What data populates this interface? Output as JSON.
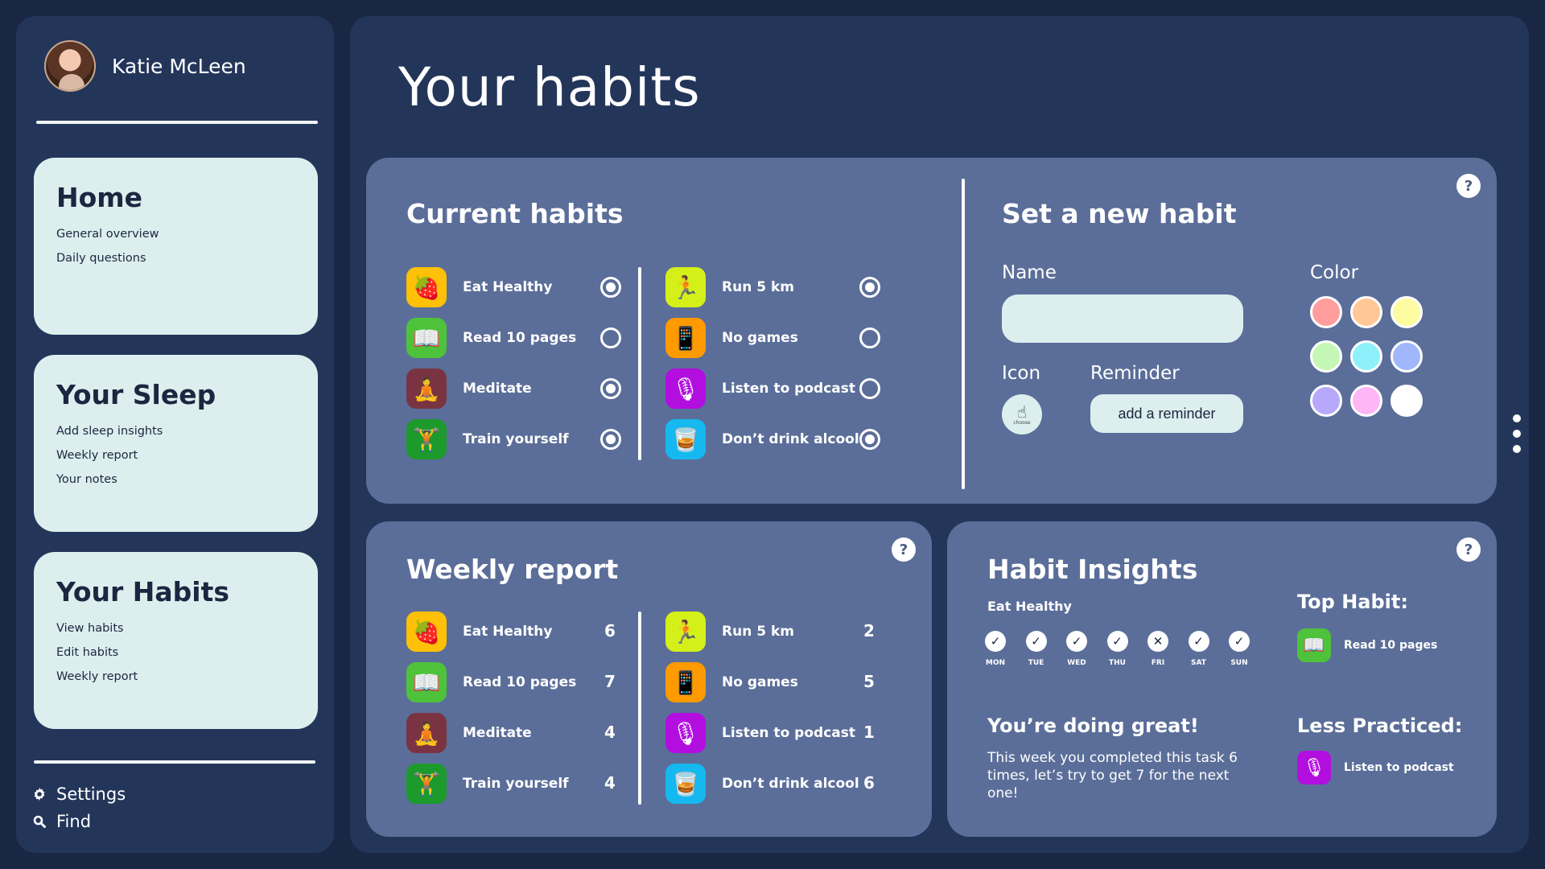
{
  "user": {
    "name": "Katie McLeen"
  },
  "nav": [
    {
      "title": "Home",
      "items": [
        "General overview",
        "Daily questions"
      ]
    },
    {
      "title": "Your Sleep",
      "items": [
        "Add sleep insights",
        "Weekly report",
        "Your notes"
      ]
    },
    {
      "title": "Your Habits",
      "items": [
        "View habits",
        "Edit habits",
        "Weekly report"
      ]
    }
  ],
  "footer": {
    "settings": "Settings",
    "find": "Find"
  },
  "page_title": "Your habits",
  "current_habits": {
    "title": "Current habits",
    "left": [
      {
        "label": "Eat Healthy",
        "icon": "🍓",
        "checked": true
      },
      {
        "label": "Read 10 pages",
        "icon": "📖",
        "checked": false
      },
      {
        "label": "Meditate",
        "icon": "🧘",
        "checked": true
      },
      {
        "label": "Train yourself",
        "icon": "🏋",
        "checked": true
      }
    ],
    "right": [
      {
        "label": "Run 5 km",
        "icon": "🏃",
        "checked": true
      },
      {
        "label": "No games",
        "icon": "📱",
        "checked": false
      },
      {
        "label": "Listen to podcast",
        "icon": "🎙",
        "checked": false
      },
      {
        "label": "Don’t drink alcool",
        "icon": "🥃",
        "checked": true
      }
    ]
  },
  "new_habit": {
    "title": "Set a new habit",
    "name_label": "Name",
    "name_value": "",
    "icon_label": "Icon",
    "icon_choose": "choose",
    "reminder_label": "Reminder",
    "reminder_button": "add a reminder",
    "color_label": "Color",
    "colors": [
      "#ff9d9d",
      "#ffc896",
      "#fdfca0",
      "#c4f7b5",
      "#8ef0fb",
      "#a0b8fb",
      "#b7a8fb",
      "#feb6f4",
      "#ffffff"
    ]
  },
  "weekly_report": {
    "title": "Weekly report",
    "left": [
      {
        "label": "Eat Healthy",
        "icon": "🍓",
        "count": "6"
      },
      {
        "label": "Read 10 pages",
        "icon": "📖",
        "count": "7"
      },
      {
        "label": "Meditate",
        "icon": "🧘",
        "count": "4"
      },
      {
        "label": "Train yourself",
        "icon": "🏋",
        "count": "4"
      }
    ],
    "right": [
      {
        "label": "Run 5 km",
        "icon": "🏃",
        "count": "2"
      },
      {
        "label": "No games",
        "icon": "📱",
        "count": "5"
      },
      {
        "label": "Listen to podcast",
        "icon": "🎙",
        "count": "1"
      },
      {
        "label": "Don’t drink alcool",
        "icon": "🥃",
        "count": "6"
      }
    ]
  },
  "insights": {
    "title": "Habit Insights",
    "habit": "Eat Healthy",
    "days": [
      {
        "label": "MON",
        "done": true
      },
      {
        "label": "TUE",
        "done": true
      },
      {
        "label": "WED",
        "done": true
      },
      {
        "label": "THU",
        "done": true
      },
      {
        "label": "FRI",
        "done": false
      },
      {
        "label": "SAT",
        "done": true
      },
      {
        "label": "SUN",
        "done": true
      }
    ],
    "headline": "You’re doing great!",
    "message": "This week you completed this task 6 times, let’s try to get 7 for the next one!",
    "top_label": "Top Habit:",
    "top_habit": "Read 10 pages",
    "less_label": "Less Practiced:",
    "less_habit": "Listen to podcast"
  },
  "icon_colors": {
    "Eat Healthy": "#ffc107",
    "Read 10 pages": "#4fc23c",
    "Meditate": "#7a3441",
    "Train yourself": "#1c9a2c",
    "Run 5 km": "#d4f018",
    "No games": "#ff9a00",
    "Listen to podcast": "#b20ee0",
    "Don’t drink alcool": "#16b8f0"
  }
}
